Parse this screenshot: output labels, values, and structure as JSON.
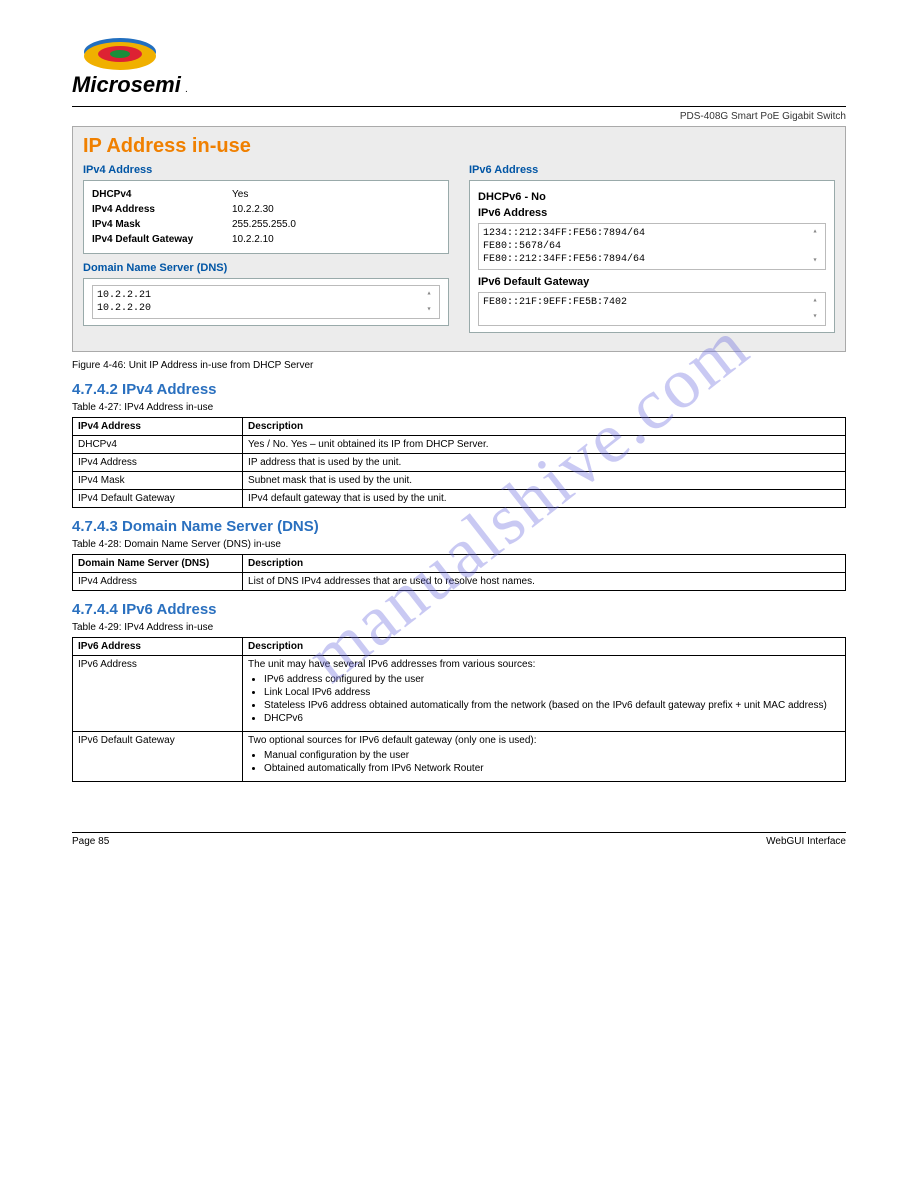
{
  "brand": "Microsemi",
  "product_line": "PDS-408G Smart PoE Gigabit Switch",
  "watermark": "manualshive.com",
  "screenshot_panel": {
    "title": "IP Address in-use",
    "ipv4": {
      "header": "IPv4 Address",
      "rows": [
        {
          "label": "DHCPv4",
          "value": "Yes"
        },
        {
          "label": "IPv4 Address",
          "value": "10.2.2.30"
        },
        {
          "label": "IPv4 Mask",
          "value": "255.255.255.0"
        },
        {
          "label": "IPv4 Default Gateway",
          "value": "10.2.2.10"
        }
      ]
    },
    "dns": {
      "header": "Domain Name Server (DNS)",
      "content": "10.2.2.21\n10.2.2.20"
    },
    "ipv6": {
      "header": "IPv6 Address",
      "dhcp_line": "DHCPv6 - No",
      "address_label": "IPv6 Address",
      "address_content": "1234::212:34FF:FE56:7894/64\nFE80::5678/64\nFE80::212:34FF:FE56:7894/64",
      "gateway_label": "IPv6 Default Gateway",
      "gateway_content": "FE80::21F:9EFF:FE5B:7402"
    }
  },
  "fig_caption": "Figure 4-46: Unit IP Address in-use from DHCP Server",
  "section1": {
    "heading": "4.7.4.2 IPv4 Address",
    "table_caption": "Table 4-27: IPv4 Address in-use",
    "headers": [
      "IPv4 Address",
      "Description"
    ],
    "rows": [
      [
        "DHCPv4",
        "Yes / No. Yes – unit obtained its IP from DHCP Server."
      ],
      [
        "IPv4 Address",
        "IP address that is used by the unit."
      ],
      [
        "IPv4 Mask",
        "Subnet mask that is used by the unit."
      ],
      [
        "IPv4 Default Gateway",
        "IPv4 default gateway that is used by the unit."
      ]
    ]
  },
  "section2": {
    "heading": "4.7.4.3 Domain Name Server (DNS)",
    "table_caption": "Table 4-28: Domain Name Server (DNS) in-use",
    "headers": [
      "Domain Name Server (DNS)",
      "Description"
    ],
    "rows": [
      [
        "IPv4 Address",
        "List of DNS IPv4 addresses that are used to resolve host names."
      ]
    ]
  },
  "section3": {
    "heading": "4.7.4.4 IPv6 Address",
    "table_caption": "Table 4-29: IPv4 Address in-use",
    "headers": [
      "IPv6 Address",
      "Description"
    ],
    "rows": [
      {
        "label": "IPv6 Address",
        "lead": "The unit may have several IPv6 addresses from various sources:",
        "bullets": [
          "IPv6 address configured by the user",
          "Link Local IPv6 address",
          "Stateless IPv6 address obtained automatically from the network (based on the IPv6 default gateway prefix + unit MAC address)",
          "DHCPv6"
        ]
      },
      {
        "label": "IPv6 Default Gateway",
        "lead": "Two optional sources for IPv6 default gateway (only one is used):",
        "bullets": [
          "Manual configuration by the user",
          "Obtained automatically from IPv6 Network Router"
        ]
      }
    ]
  },
  "footer": {
    "left": "Page 85",
    "right": "WebGUI Interface"
  }
}
